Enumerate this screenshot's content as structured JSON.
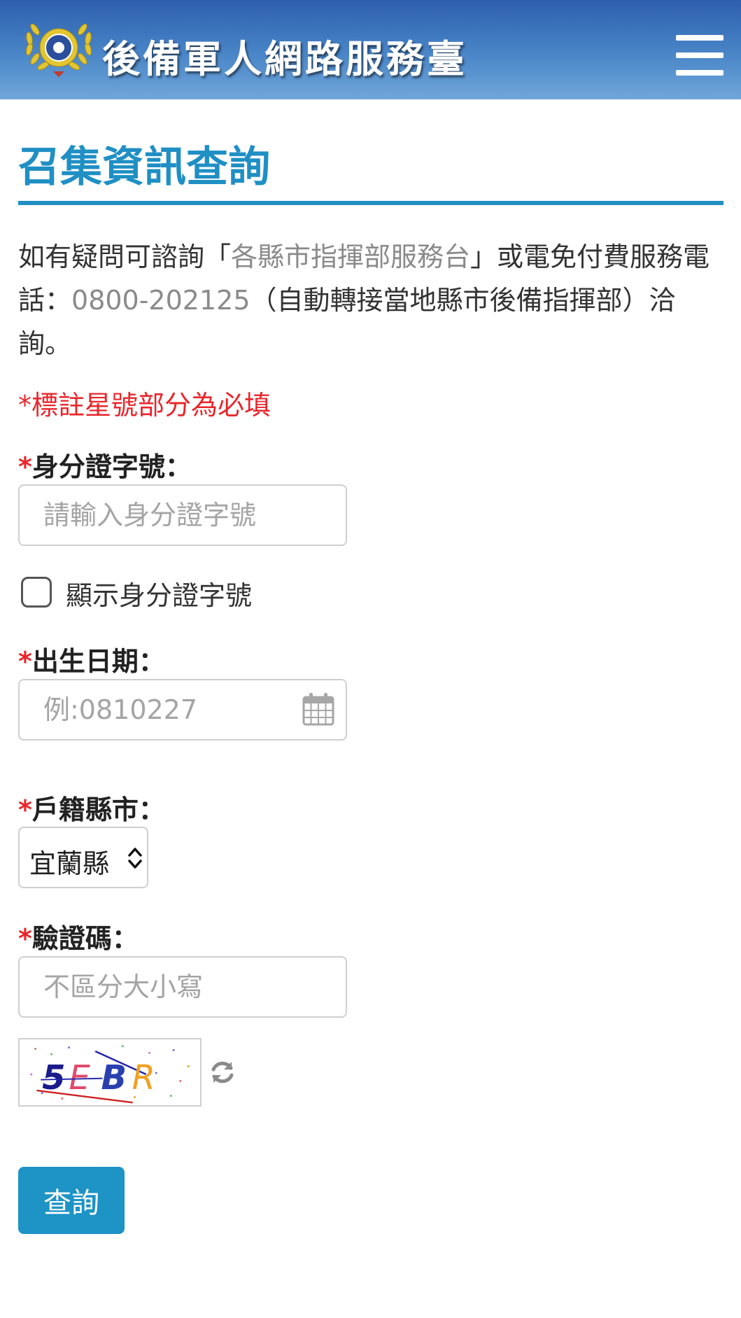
{
  "header": {
    "site_title": "後備軍人網路服務臺",
    "menu_icon": "hamburger-menu-icon",
    "emblem_icon": "military-emblem-icon"
  },
  "page": {
    "title": "召集資訊查詢",
    "intro": {
      "part1": "如有疑問可諮詢「",
      "link_text": "各縣市指揮部服務台",
      "part2": "」或電免付費服務電話：",
      "phone": "0800-202125",
      "part3": "（自動轉接當地縣市後備指揮部）洽詢。"
    },
    "required_note": "*標註星號部分為必填"
  },
  "form": {
    "required_mark": "*",
    "id_number": {
      "label": "身分證字號：",
      "placeholder": "請輸入身分證字號",
      "value": ""
    },
    "show_id_checkbox": {
      "label": "顯示身分證字號",
      "checked": false
    },
    "birth_date": {
      "label": "出生日期：",
      "placeholder": "例:0810227",
      "value": "",
      "icon": "calendar-icon"
    },
    "household_city": {
      "label": "戶籍縣市：",
      "selected": "宜蘭縣"
    },
    "captcha": {
      "label": "驗證碼：",
      "placeholder": "不區分大小寫",
      "value": "",
      "image_text": "5EBR",
      "refresh_icon": "refresh-icon"
    },
    "submit_label": "查詢"
  },
  "colors": {
    "accent": "#1f8fc4",
    "required": "#e8262b",
    "button": "#1d93c6",
    "header_top": "#2c5fae",
    "header_bottom": "#6fa6d9"
  }
}
